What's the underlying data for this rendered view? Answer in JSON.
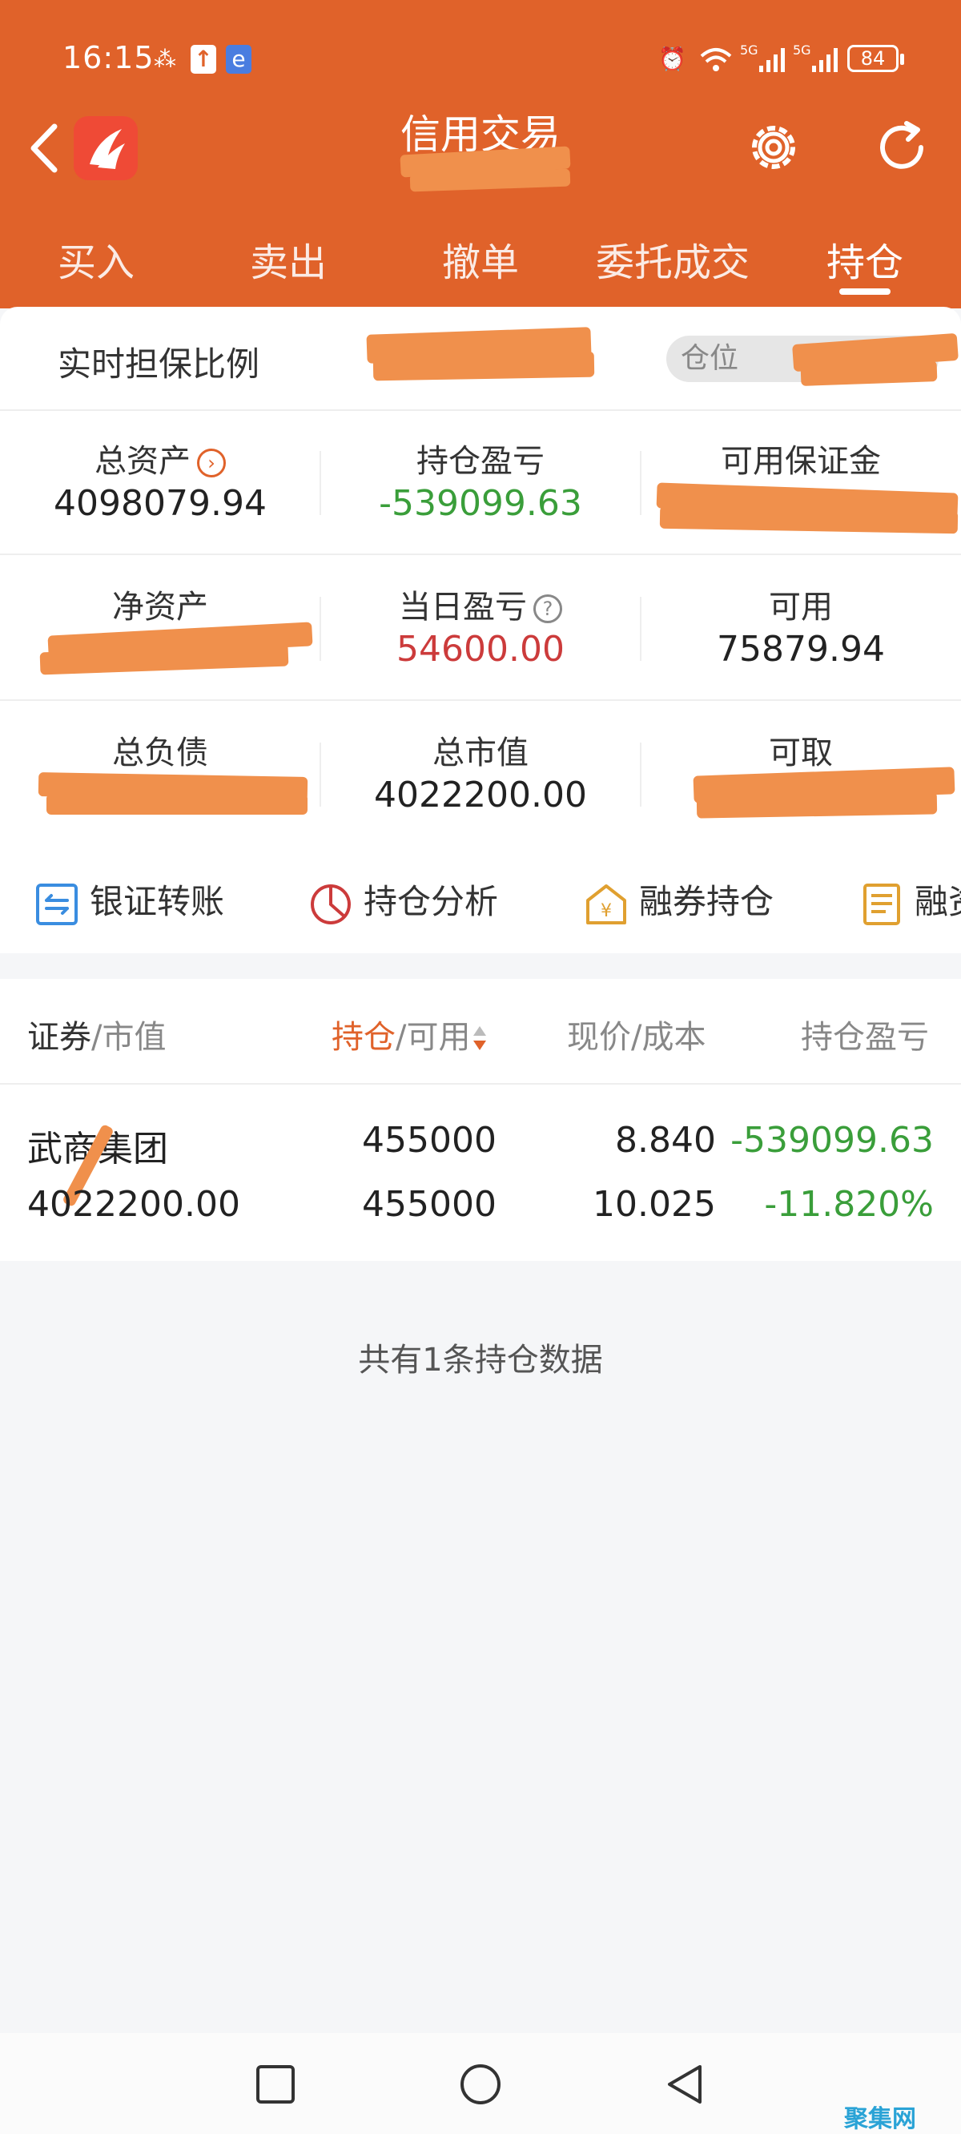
{
  "status_bar": {
    "time": "16:15",
    "signal_1": "5G",
    "signal_2": "5G",
    "battery": "84"
  },
  "header": {
    "title": "信用交易"
  },
  "tabs": [
    {
      "label": "买入"
    },
    {
      "label": "卖出"
    },
    {
      "label": "撤单"
    },
    {
      "label": "委托成交"
    },
    {
      "label": "持仓",
      "active": true
    }
  ],
  "guarantee": {
    "label": "实时担保比例",
    "position_label": "仓位"
  },
  "summary": {
    "total_assets": {
      "label": "总资产",
      "value": "4098079.94"
    },
    "position_pnl": {
      "label": "持仓盈亏",
      "value": "-539099.63"
    },
    "available_margin": {
      "label": "可用保证金"
    },
    "net_assets": {
      "label": "净资产"
    },
    "daily_pnl": {
      "label": "当日盈亏",
      "value": "54600.00"
    },
    "available": {
      "label": "可用",
      "value": "75879.94"
    },
    "total_liabilities": {
      "label": "总负债"
    },
    "total_market_value": {
      "label": "总市值",
      "value": "4022200.00"
    },
    "withdrawable": {
      "label": "可取"
    }
  },
  "tools": [
    {
      "label": "银证转账",
      "icon": "bank-transfer-icon"
    },
    {
      "label": "持仓分析",
      "icon": "pie-chart-icon"
    },
    {
      "label": "融券持仓",
      "icon": "yen-house-icon"
    },
    {
      "label": "融资",
      "icon": "funding-doc-icon"
    }
  ],
  "table": {
    "headers": {
      "security": "证券",
      "market_value": "/市值",
      "position": "持仓",
      "available": "/可用",
      "price_cost": "现价/成本",
      "pnl": "持仓盈亏"
    },
    "rows": [
      {
        "name": "武商集团",
        "market_value": "4022200.00",
        "position": "455000",
        "available": "455000",
        "price": "8.840",
        "cost": "10.025",
        "pnl": "-539099.63",
        "pnl_pct": "-11.820%"
      }
    ]
  },
  "footer_note": "共有1条持仓数据",
  "watermark": "聚集网",
  "colors": {
    "brand": "#e0622a",
    "gain": "#cc3b3b",
    "loss": "#3a9e3a"
  }
}
